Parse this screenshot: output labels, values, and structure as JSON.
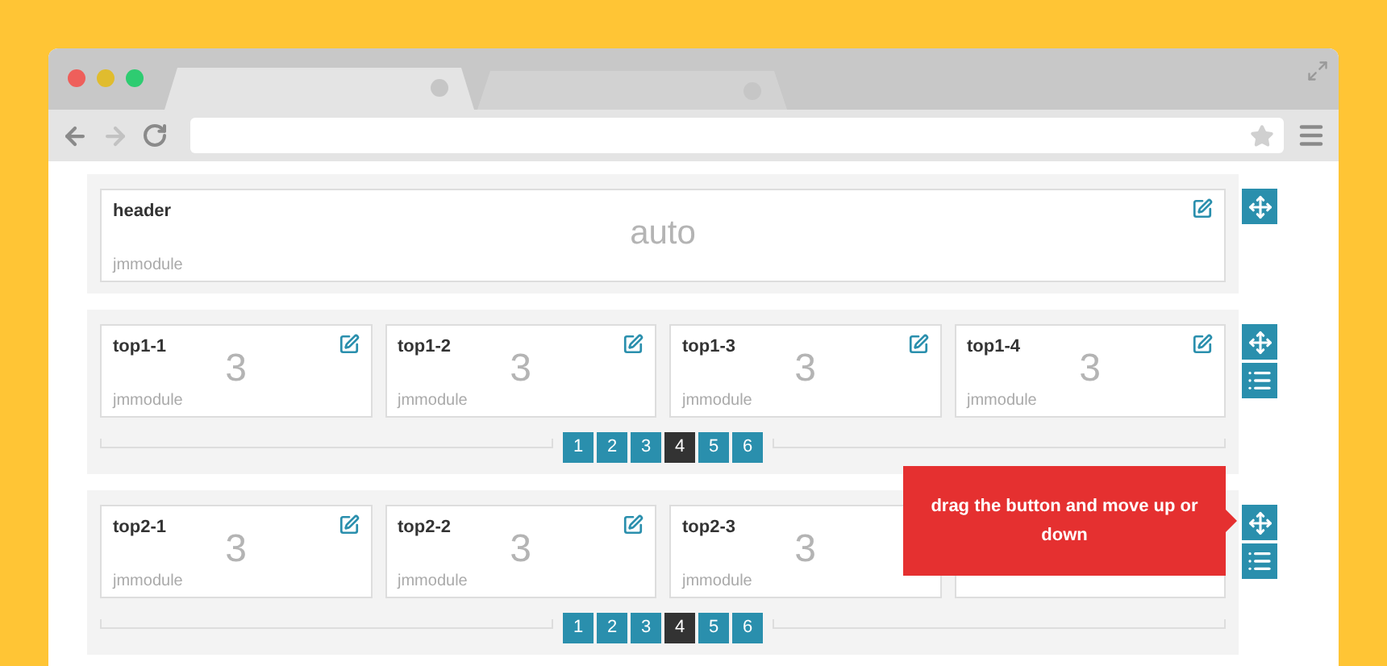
{
  "browser": {
    "tabs": [
      {
        "selected": true
      },
      {
        "selected": false
      }
    ]
  },
  "rows": [
    {
      "columns": [
        {
          "title": "header",
          "size": "auto",
          "module": "jmmodule",
          "editable": true
        }
      ],
      "actions": [
        {
          "kind": "move"
        }
      ]
    },
    {
      "columns": [
        {
          "title": "top1-1",
          "size": "3",
          "module": "jmmodule",
          "editable": true
        },
        {
          "title": "top1-2",
          "size": "3",
          "module": "jmmodule",
          "editable": true
        },
        {
          "title": "top1-3",
          "size": "3",
          "module": "jmmodule",
          "editable": true
        },
        {
          "title": "top1-4",
          "size": "3",
          "module": "jmmodule",
          "editable": true
        }
      ],
      "pagination": [
        {
          "label": "1",
          "selected": false
        },
        {
          "label": "2",
          "selected": false
        },
        {
          "label": "3",
          "selected": false
        },
        {
          "label": "4",
          "selected": true
        },
        {
          "label": "5",
          "selected": false
        },
        {
          "label": "6",
          "selected": false
        }
      ],
      "actions": [
        {
          "kind": "move"
        },
        {
          "kind": "layout"
        }
      ]
    },
    {
      "columns": [
        {
          "title": "top2-1",
          "size": "3",
          "module": "jmmodule",
          "editable": true
        },
        {
          "title": "top2-2",
          "size": "3",
          "module": "jmmodule",
          "editable": true
        },
        {
          "title": "top2-3",
          "size": "3",
          "module": "jmmodule"
        },
        {}
      ],
      "pagination": [
        {
          "label": "1",
          "selected": false
        },
        {
          "label": "2",
          "selected": false
        },
        {
          "label": "3",
          "selected": false
        },
        {
          "label": "4",
          "selected": true
        },
        {
          "label": "5",
          "selected": false
        },
        {
          "label": "6",
          "selected": false
        }
      ],
      "actions": [
        {
          "kind": "move"
        },
        {
          "kind": "layout"
        }
      ],
      "tooltip": {
        "text": "drag the button and move up or down"
      }
    }
  ]
}
